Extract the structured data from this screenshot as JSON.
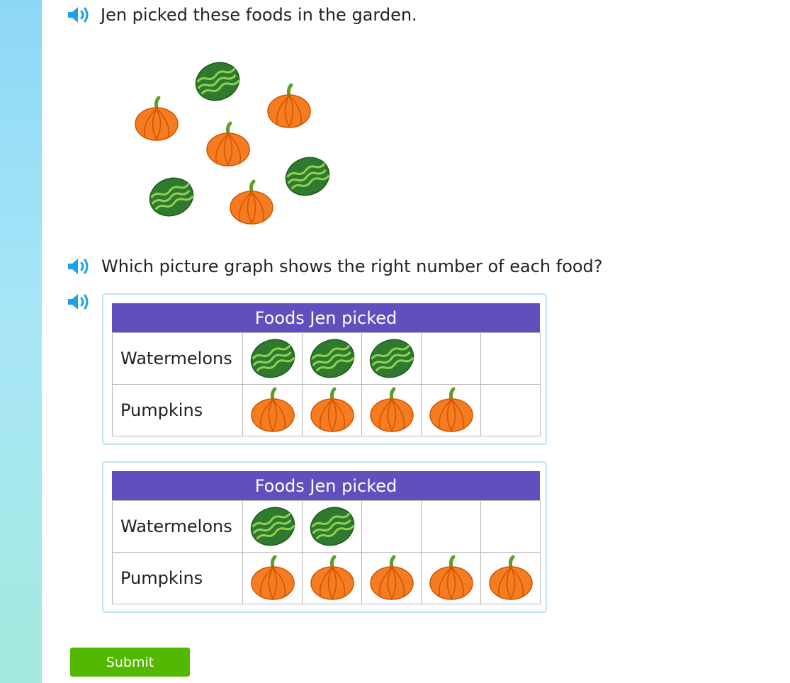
{
  "sidebar": {
    "color": "#8dd8f6"
  },
  "question": {
    "intro": "Jen picked these foods in the garden.",
    "prompt": "Which picture graph shows the right number of each food?",
    "scene_items": [
      "watermelon-icon",
      "pumpkin-icon",
      "pumpkin-icon",
      "pumpkin-icon",
      "watermelon-icon",
      "pumpkin-icon",
      "watermelon-icon"
    ]
  },
  "choices": [
    {
      "title": "Foods Jen picked",
      "rows": [
        {
          "label": "Watermelons",
          "icon": "watermelon-icon",
          "count": 3
        },
        {
          "label": "Pumpkins",
          "icon": "pumpkin-icon",
          "count": 4
        }
      ]
    },
    {
      "title": "Foods Jen picked",
      "rows": [
        {
          "label": "Watermelons",
          "icon": "watermelon-icon",
          "count": 2
        },
        {
          "label": "Pumpkins",
          "icon": "pumpkin-icon",
          "count": 5
        }
      ]
    }
  ],
  "submit": {
    "label": "Submit",
    "color": "#55b800"
  },
  "colors": {
    "accent": "#6050bd",
    "speaker": "#1aa3e8",
    "choice_border": "#bfe6f3"
  }
}
